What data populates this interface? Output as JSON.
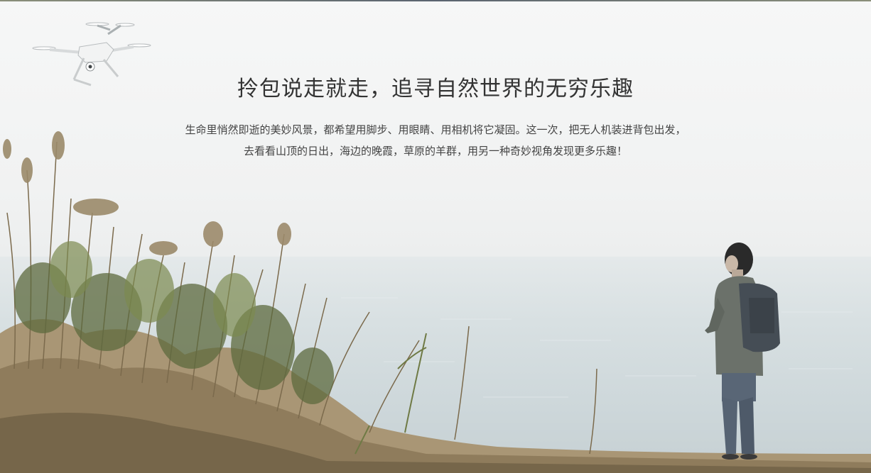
{
  "banner": {
    "title": "拎包说走就走，追寻自然世界的无穷乐趣",
    "paragraph_lines": [
      "生命里悄然即逝的美妙风景，都希望用脚步、用眼睛、用相机将它凝固。这一次，把无人机装进背包出发，",
      "去看看山顶的日出，海边的晚霞，草原的羊群，用另一种奇妙视角发现更多乐趣！"
    ]
  },
  "images": {
    "drone": "drone-illustration",
    "person": "person-with-backpack",
    "foreground": "dry-reed-grass",
    "background": "sea-and-hazy-sky"
  },
  "colors": {
    "title": "#333333",
    "text": "#444444",
    "sky": "#f3f4f4",
    "sea": "#cfd8da"
  }
}
